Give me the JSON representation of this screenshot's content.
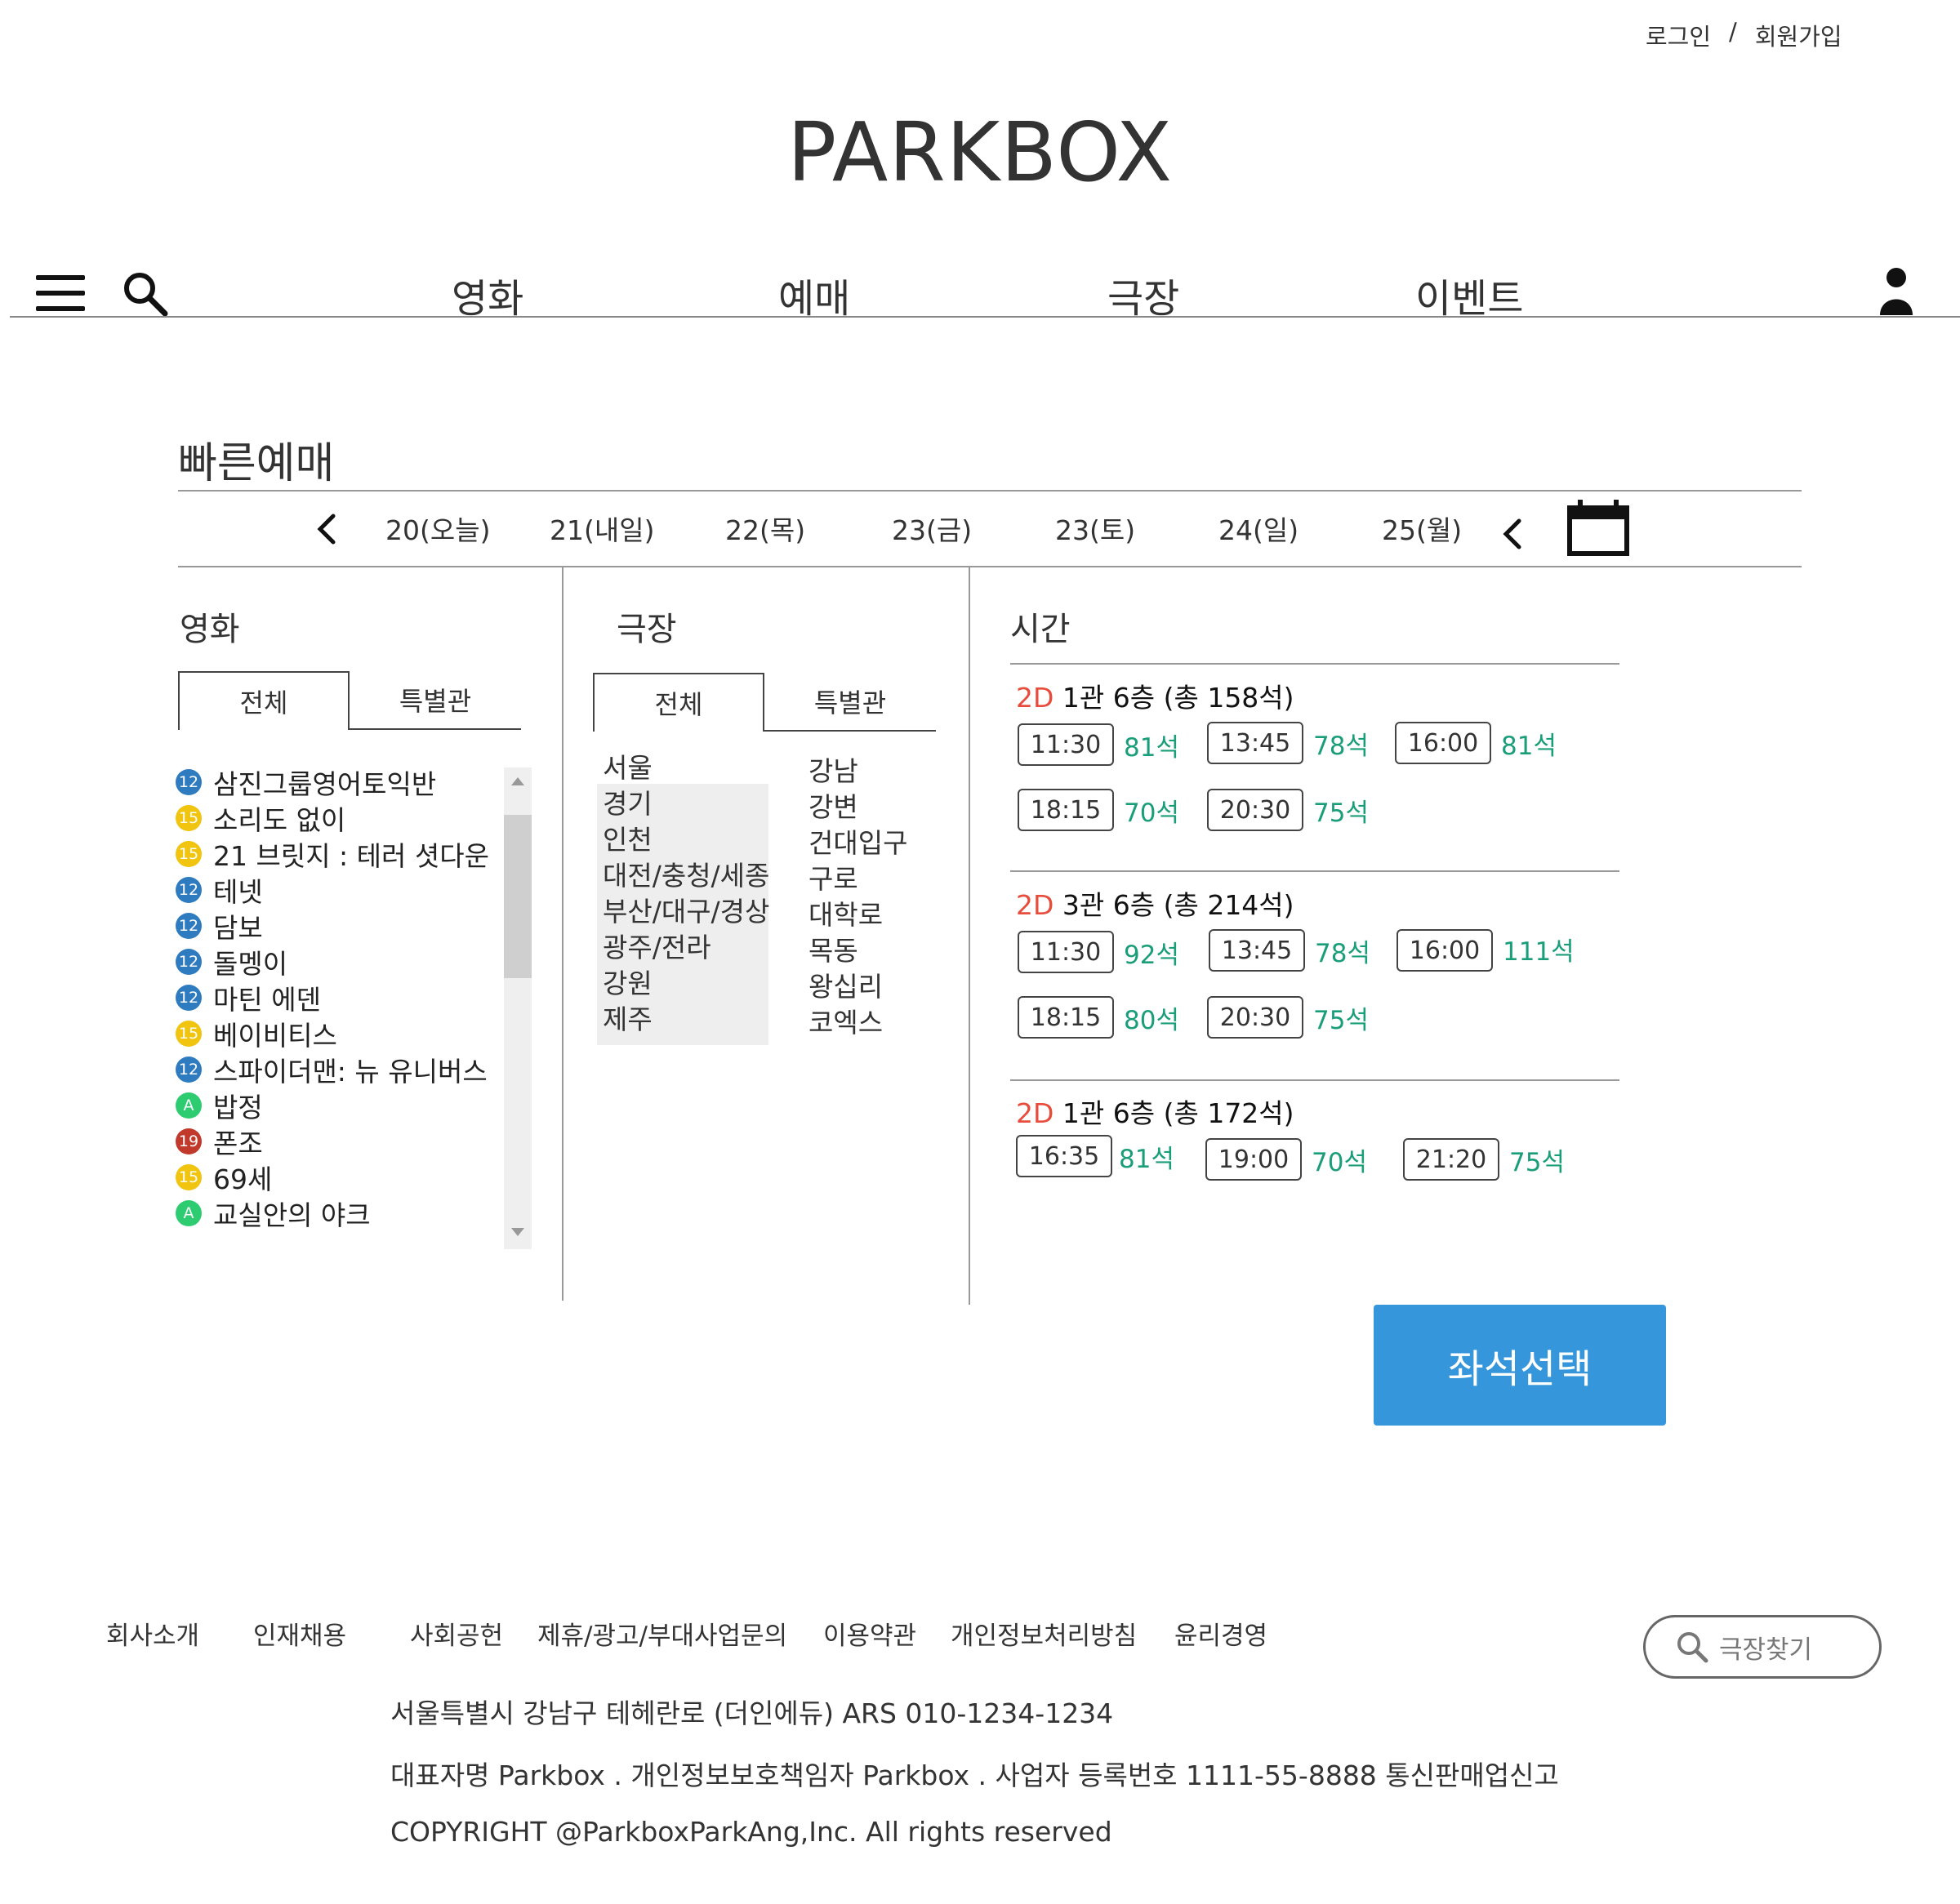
{
  "header": {
    "login": "로그인",
    "sep": "/",
    "signup": "회원가입",
    "logo": "PARKBOX",
    "nav": [
      "영화",
      "예매",
      "극장",
      "이벤트"
    ]
  },
  "booking": {
    "title": "빠른예매",
    "dates": [
      "20(오늘)",
      "21(내일)",
      "22(목)",
      "23(금)",
      "23(토)",
      "24(일)",
      "25(월)"
    ],
    "movie_section": {
      "title": "영화",
      "tabs": [
        "전체",
        "특별관"
      ],
      "movies": [
        {
          "rating": "12",
          "color": "#2e7bbf",
          "title": "삼진그룹영어토익반"
        },
        {
          "rating": "15",
          "color": "#f1c40f",
          "title": "소리도 없이"
        },
        {
          "rating": "15",
          "color": "#f1c40f",
          "title": "21 브릿지 : 테러 셧다운"
        },
        {
          "rating": "12",
          "color": "#2e7bbf",
          "title": "테넷"
        },
        {
          "rating": "12",
          "color": "#2e7bbf",
          "title": "담보"
        },
        {
          "rating": "12",
          "color": "#2e7bbf",
          "title": "돌멩이"
        },
        {
          "rating": "12",
          "color": "#2e7bbf",
          "title": "마틴 에덴"
        },
        {
          "rating": "15",
          "color": "#f1c40f",
          "title": "베이비티스"
        },
        {
          "rating": "12",
          "color": "#2e7bbf",
          "title": "스파이더맨: 뉴 유니버스"
        },
        {
          "rating": "A",
          "color": "#2ecc71",
          "title": "밥정"
        },
        {
          "rating": "19",
          "color": "#c0392b",
          "title": "폰조"
        },
        {
          "rating": "15",
          "color": "#f1c40f",
          "title": "69세"
        },
        {
          "rating": "A",
          "color": "#2ecc71",
          "title": "교실안의 야크"
        }
      ]
    },
    "theater_section": {
      "title": "극장",
      "tabs": [
        "전체",
        "특별관"
      ],
      "regions": [
        "서울",
        "경기",
        "인천",
        "대전/충청/세종",
        "부산/대구/경상",
        "광주/전라",
        "강원",
        "제주"
      ],
      "theaters": [
        "강남",
        "강변",
        "건대입구",
        "구로",
        "대학로",
        "목동",
        "왕십리",
        "코엑스"
      ]
    },
    "time_section": {
      "title": "시간",
      "halls": [
        {
          "format": "2D",
          "name": "1관 6층  (총 158석)",
          "times": [
            [
              "11:30",
              "81석"
            ],
            [
              "13:45",
              "78석"
            ],
            [
              "16:00",
              "81석"
            ],
            [
              "18:15",
              "70석"
            ],
            [
              "20:30",
              "75석"
            ]
          ]
        },
        {
          "format": "2D",
          "name": "3관 6층  (총 214석)",
          "times": [
            [
              "11:30",
              "92석"
            ],
            [
              "13:45",
              "78석"
            ],
            [
              "16:00",
              "111석"
            ],
            [
              "18:15",
              "80석"
            ],
            [
              "20:30",
              "75석"
            ]
          ]
        },
        {
          "format": "2D",
          "name": "1관 6층  (총 172석)",
          "times": [
            [
              "16:35",
              "81석"
            ],
            [
              "19:00",
              "70석"
            ],
            [
              "21:20",
              "75석"
            ]
          ]
        }
      ]
    },
    "seat_button": "좌석선택"
  },
  "footer": {
    "links": [
      "회사소개",
      "인재채용",
      "사회공헌",
      "제휴/광고/부대사업문의",
      "이용약관",
      "개인정보처리방침",
      "윤리경영"
    ],
    "search_placeholder": "극장찾기",
    "address": "서울특별시 강남구 테헤란로 (더인에듀) ARS 010-1234-1234",
    "business": "대표자명 Parkbox . 개인정보보호책임자 Parkbox . 사업자 등록번호 1111-55-8888 통신판매업신고",
    "copyright": "COPYRIGHT @ParkboxParkAng,Inc. All rights reserved"
  }
}
